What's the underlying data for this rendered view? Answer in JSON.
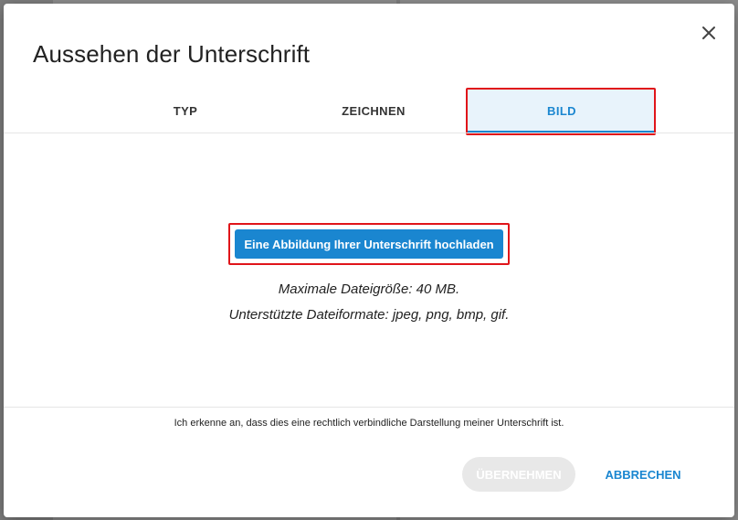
{
  "dialog": {
    "title": "Aussehen der Unterschrift",
    "close_icon": "close-icon"
  },
  "tabs": [
    {
      "label": "TYP",
      "active": false
    },
    {
      "label": "ZEICHNEN",
      "active": false
    },
    {
      "label": "BILD",
      "active": true
    }
  ],
  "upload": {
    "button_label": "Eine Abbildung Ihrer Unterschrift hochladen",
    "max_size": "Maximale Dateigröße: 40 MB.",
    "formats": "Unterstützte Dateiformate: jpeg, png, bmp, gif."
  },
  "footer": {
    "legal_text": "Ich erkenne an, dass dies eine rechtlich verbindliche Darstellung meiner Unterschrift ist.",
    "apply_label": "ÜBERNEHMEN",
    "cancel_label": "ABBRECHEN"
  },
  "colors": {
    "accent": "#1a86d0",
    "highlight": "#e0151a",
    "disabled_button": "#e8e8e8"
  }
}
